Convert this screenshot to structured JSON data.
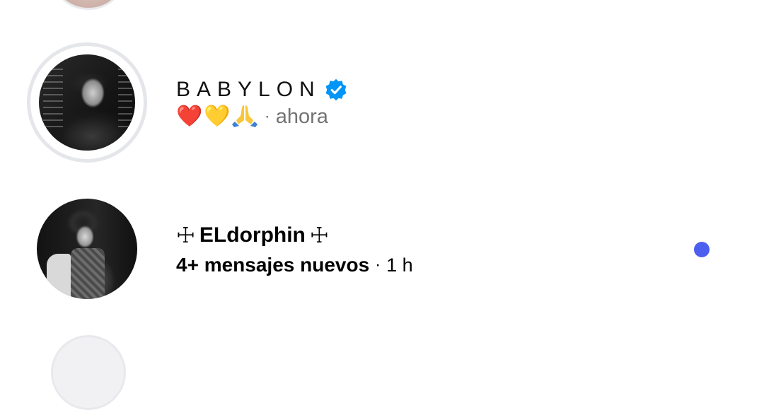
{
  "threads": [
    {
      "name": "BABYLON",
      "verified": true,
      "preview_emojis": [
        "❤️",
        "💛",
        "🙏"
      ],
      "separator": "·",
      "time": "ahora",
      "has_story": true,
      "unread": false
    },
    {
      "name_prefix_symbol": "☩",
      "name": "ELdorphin",
      "name_suffix_symbol": "☩",
      "preview": "4+ mensajes nuevos",
      "separator": "·",
      "time": "1 h",
      "unread": true
    }
  ],
  "colors": {
    "verified_badge": "#0095f6",
    "unread_dot": "#4c5fef",
    "secondary_text": "#737373",
    "story_ring": "#e4e6ea"
  }
}
